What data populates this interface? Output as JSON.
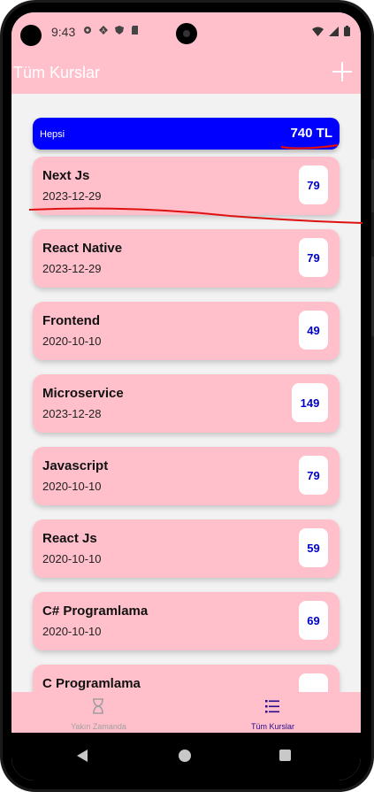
{
  "status_bar": {
    "time": "9:43",
    "icons_left": [
      "gear-icon",
      "a-icon",
      "shield-icon",
      "sd-card-icon"
    ],
    "icons_right": [
      "wifi-icon",
      "signal-icon",
      "battery-icon"
    ]
  },
  "app_bar": {
    "title": "Tüm Kurslar",
    "add_icon": "plus-icon"
  },
  "summary": {
    "label": "Hepsi",
    "total": "740 TL",
    "color": "#0000ff"
  },
  "courses": [
    {
      "name": "Next Js",
      "date": "2023-12-29",
      "price": "79"
    },
    {
      "name": "React Native",
      "date": "2023-12-29",
      "price": "79"
    },
    {
      "name": "Frontend",
      "date": "2020-10-10",
      "price": "49"
    },
    {
      "name": "Microservice",
      "date": "2023-12-28",
      "price": "149"
    },
    {
      "name": "Javascript",
      "date": "2020-10-10",
      "price": "79"
    },
    {
      "name": "React Js",
      "date": "2020-10-10",
      "price": "59"
    },
    {
      "name": "C# Programlama",
      "date": "2020-10-10",
      "price": "69"
    },
    {
      "name": "C Programlama",
      "date": "",
      "price": ""
    }
  ],
  "bottom_nav": {
    "items": [
      {
        "label": "Yakın Zamanda",
        "icon": "hourglass-icon",
        "active": false
      },
      {
        "label": "Tüm Kurslar",
        "icon": "list-icon",
        "active": true
      }
    ],
    "active_color": "#2a0a8c",
    "inactive_color": "#a0a0a0"
  },
  "theme": {
    "primary": "#ffc0cb",
    "accent": "#0000ff",
    "annotation": "#e01010"
  }
}
